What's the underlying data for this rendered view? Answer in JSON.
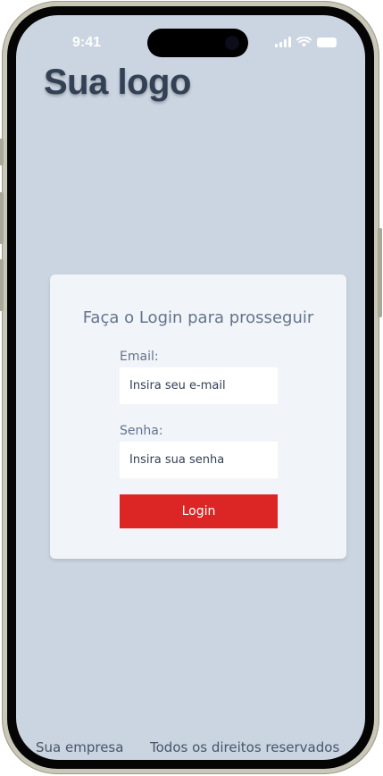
{
  "status_bar": {
    "time": "9:41"
  },
  "header": {
    "logo_text": "Sua logo"
  },
  "login_card": {
    "title": "Faça o Login para prosseguir",
    "email": {
      "label": "Email:",
      "placeholder": "Insira seu e-mail",
      "value": ""
    },
    "password": {
      "label": "Senha:",
      "placeholder": "Insira sua senha",
      "value": ""
    },
    "submit_label": "Login"
  },
  "footer": {
    "company": "Sua empresa",
    "rights": "Todos os direitos reservados"
  },
  "colors": {
    "background": "#cbd5e1",
    "card": "#f1f5f9",
    "logo": "#334155",
    "button": "#dc2626",
    "muted_text": "#64748b"
  },
  "icons": [
    "signal-icon",
    "wifi-icon",
    "battery-icon"
  ]
}
